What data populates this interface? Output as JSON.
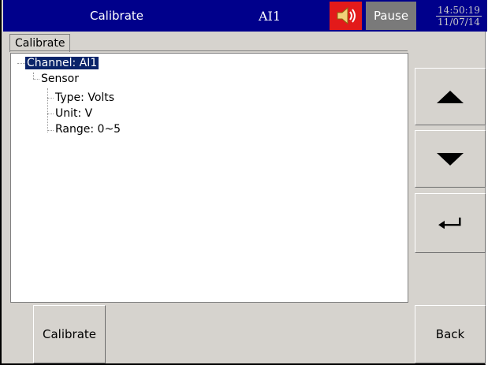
{
  "titlebar": {
    "title": "Calibrate",
    "channel": "AI1",
    "speaker_icon": "speaker-icon",
    "pause_label": "Pause",
    "time": "14:50:19",
    "date": "11/07/14",
    "colors": {
      "bar": "#00008b",
      "speaker_bg": "#e31a1a",
      "pause_bg": "#7a7a7a"
    }
  },
  "tab": {
    "label": "Calibrate"
  },
  "tree": {
    "items": [
      {
        "label": "Channel: AI1",
        "selected": true
      },
      {
        "label": "Sensor"
      },
      {
        "label": "Type: Volts"
      },
      {
        "label": "Unit: V"
      },
      {
        "label": "Range: 0~5"
      }
    ]
  },
  "side_buttons": {
    "up_icon": "arrow-up-icon",
    "down_icon": "arrow-down-icon",
    "enter_icon": "enter-return-icon"
  },
  "bottom_buttons": {
    "calibrate_label": "Calibrate",
    "back_label": "Back"
  }
}
